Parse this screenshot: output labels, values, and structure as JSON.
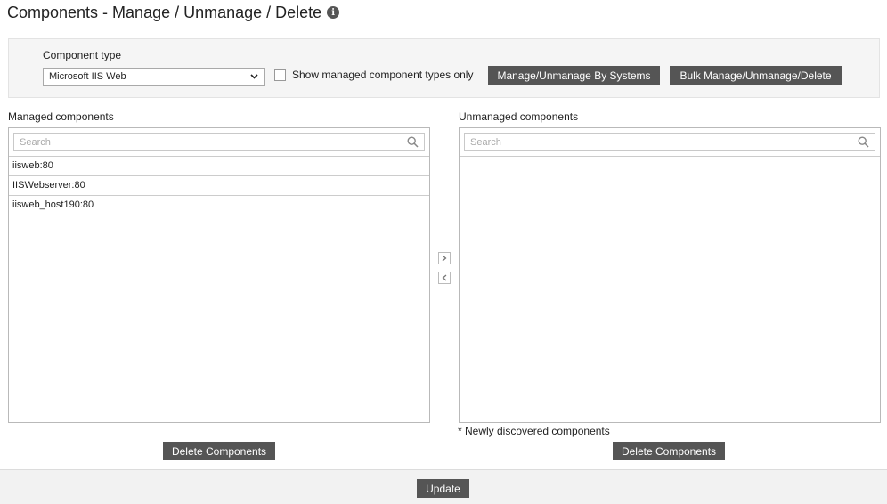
{
  "page": {
    "title": "Components - Manage / Unmanage / Delete"
  },
  "filters": {
    "component_type_label": "Component type",
    "component_type_value": "Microsoft IIS Web",
    "show_managed_label": "Show managed component types only",
    "show_managed_checked": false,
    "manage_by_systems_label": "Manage/Unmanage By Systems",
    "bulk_label": "Bulk Manage/Unmanage/Delete"
  },
  "managed": {
    "label": "Managed components",
    "search_placeholder": "Search",
    "items": [
      "iisweb:80",
      "IISWebserver:80",
      "iisweb_host190:80"
    ],
    "delete_label": "Delete Components"
  },
  "unmanaged": {
    "label": "Unmanaged components",
    "search_placeholder": "Search",
    "items": [],
    "note": "* Newly discovered components",
    "delete_label": "Delete Components"
  },
  "footer": {
    "update_label": "Update"
  },
  "icons": {
    "info": "info-icon",
    "dropdown": "chevron-down-icon",
    "search": "search-icon",
    "move_right": "chevron-right-icon",
    "move_left": "chevron-left-icon"
  },
  "colors": {
    "button_bg": "#555555",
    "panel_bg": "#f5f5f5"
  }
}
